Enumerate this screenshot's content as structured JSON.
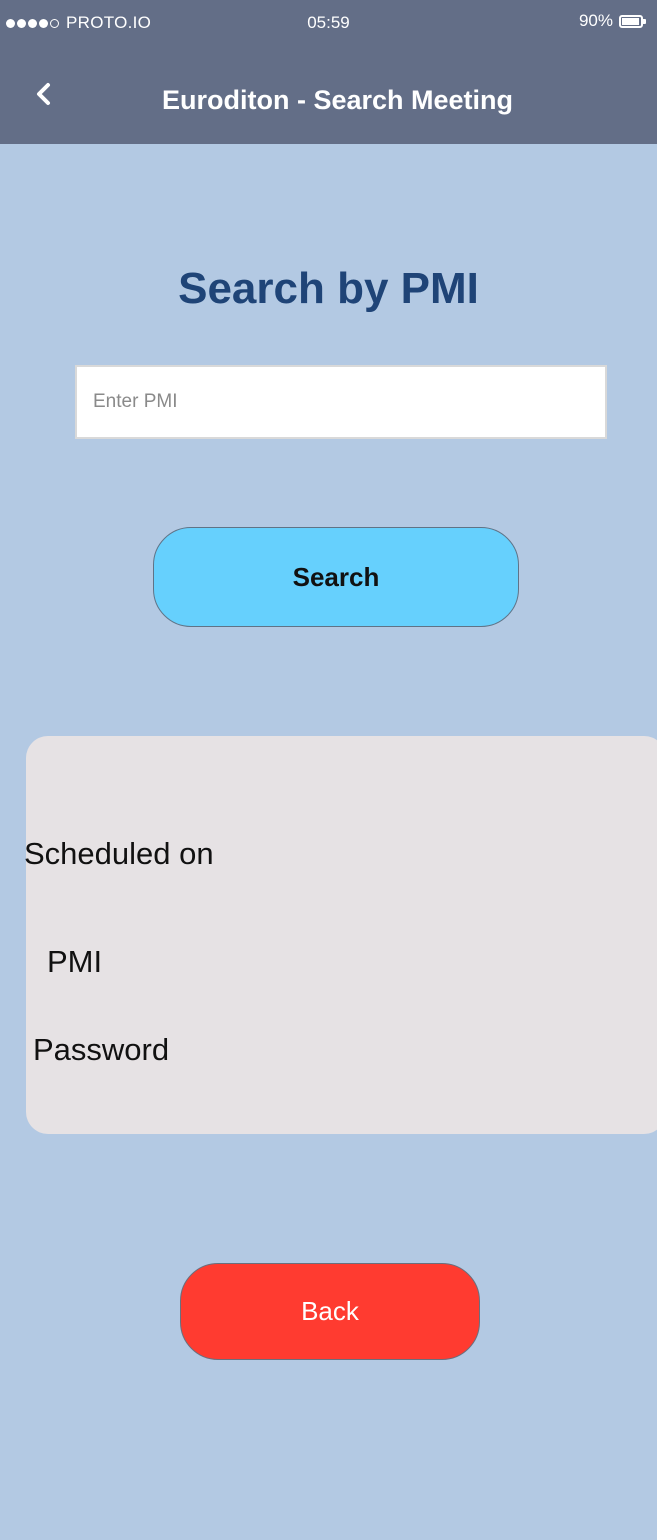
{
  "status_bar": {
    "carrier": "PROTO.IO",
    "time": "05:59",
    "battery": "90%",
    "signal_dots_filled": 4,
    "signal_dots_total": 5
  },
  "nav_bar": {
    "back_icon": "chevron-left-icon",
    "title": "Euroditon - Search Meeting"
  },
  "main": {
    "heading": "Search by PMI",
    "pmi_input": {
      "placeholder": "Enter PMI",
      "value": ""
    },
    "search_label": "Search"
  },
  "info_card": {
    "scheduled_label": "Scheduled on",
    "pmi_label": "PMI",
    "password_label": "Password"
  },
  "back_label": "Back",
  "colors": {
    "background": "#b3c9e3",
    "bar": "#636e87",
    "heading": "#1f4477",
    "search_button": "#66d0fd",
    "back_button": "#ff3b30",
    "card": "#e6e2e4"
  }
}
